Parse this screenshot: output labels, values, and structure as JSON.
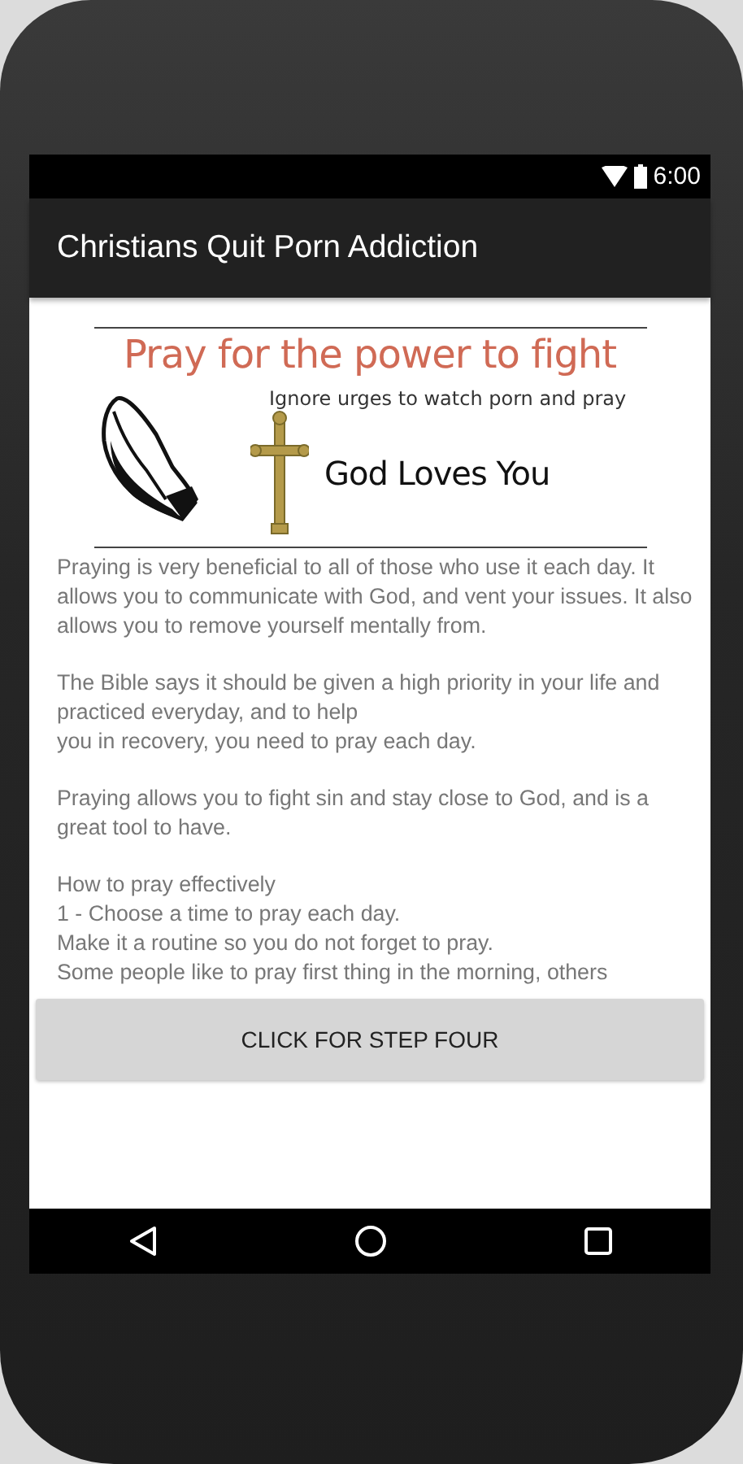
{
  "status_bar": {
    "time": "6:00"
  },
  "app_bar": {
    "title": "Christians Quit Porn Addiction"
  },
  "banner": {
    "headline": "Pray for the power to fight",
    "subtitle": "Ignore urges to watch porn and pray",
    "tagline": "God Loves You"
  },
  "paragraphs": [
    "Praying is very beneficial to all of those who use it each day. It allows you to communicate with God, and vent your issues. It also allows you to remove yourself mentally from.",
    " The Bible says it should be given a high priority in your life and practiced everyday, and to help\n you in recovery, you need to pray each day.",
    " Praying allows you to fight sin and stay close to God, and is a great tool to have.",
    " How to pray effectively\n 1 - Choose a time to pray each day.\n Make it a routine so you do not forget to pray.\n Some people like to pray first thing in the morning, others"
  ],
  "button": {
    "label": "CLICK FOR STEP FOUR"
  }
}
